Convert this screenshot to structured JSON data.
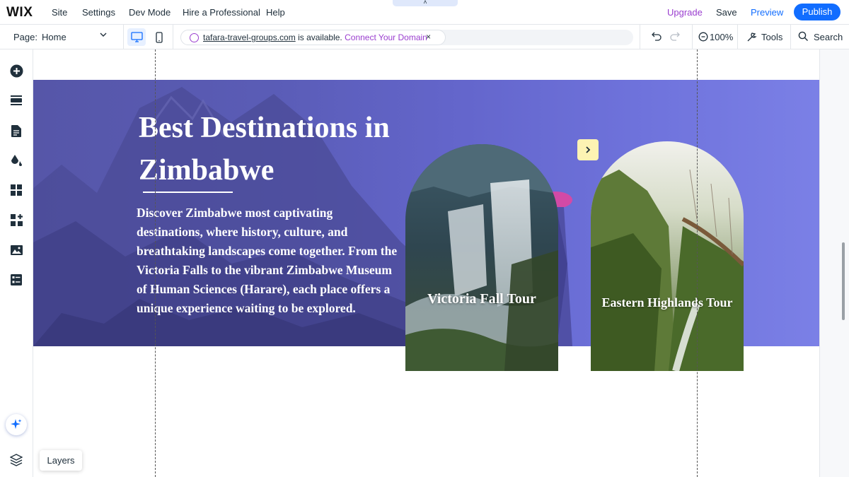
{
  "topbar": {
    "logo": "WIX",
    "menu": [
      "Site",
      "Settings",
      "Dev Mode",
      "Hire a Professional",
      "Help"
    ],
    "upgrade": "Upgrade",
    "save": "Save",
    "preview": "Preview",
    "publish": "Publish",
    "collapse_glyph": "˄"
  },
  "pagebar": {
    "page_label": "Page:",
    "page_value": "Home",
    "domain": "tafara-travel-groups.com",
    "availability": "is available.",
    "connect": "Connect Your Domain",
    "close_glyph": "×",
    "zoom": "100%",
    "tools": "Tools",
    "search": "Search"
  },
  "leftrail": {
    "icons": [
      "add-icon",
      "sections-icon",
      "pages-icon",
      "design-icon",
      "apps-icon",
      "add-apps-icon",
      "media-icon",
      "cms-icon"
    ],
    "layers_tooltip": "Layers"
  },
  "hero": {
    "title": "Best Destinations in Zimbabwe",
    "body": "Discover Zimbabwe most captivating destinations, where history, culture, and breathtaking landscapes come together. From the Victoria Falls to the vibrant Zimbabwe Museum of Human Sciences (Harare), each place offers a unique experience waiting to be explored.",
    "cards": [
      {
        "label": "Victoria Fall Tour"
      },
      {
        "label": "Eastern Highlands Tour"
      }
    ],
    "next_glyph": "›"
  },
  "colors": {
    "accent": "#116dff",
    "upgrade": "#9a3ecf",
    "hero_overlay": "#6466cc",
    "next_button": "#fdf3b3"
  }
}
